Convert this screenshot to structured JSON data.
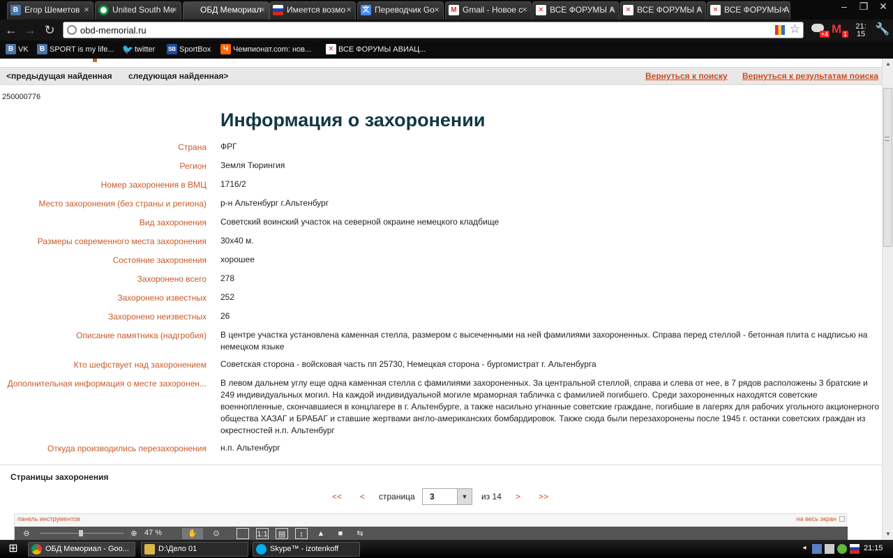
{
  "browser": {
    "tabs": [
      {
        "label": "Егор Шеметов",
        "favicon": "В",
        "favicon_class": "fav-vk",
        "close": "×"
      },
      {
        "label": "United South Me",
        "favicon": "",
        "favicon_class": "fav-ring",
        "close": "×"
      },
      {
        "label": "ОБД Мемориал",
        "favicon": "",
        "favicon_class": "fav-memorial",
        "close": "×"
      },
      {
        "label": "Имеется возмо",
        "favicon": "",
        "favicon_class": "fav-flag",
        "close": "×"
      },
      {
        "label": "Переводчик Go",
        "favicon": "文",
        "favicon_class": "fav-tr",
        "close": "×"
      },
      {
        "label": "Gmail - Новое с",
        "favicon": "M",
        "favicon_class": "fav-gmail",
        "close": "×"
      },
      {
        "label": "ВСЕ ФОРУМЫ А",
        "favicon": "✕",
        "favicon_class": "fav-forum",
        "close": "×"
      },
      {
        "label": "ВСЕ ФОРУМЫ А",
        "favicon": "✕",
        "favicon_class": "fav-forum",
        "close": "×"
      },
      {
        "label": "ВСЕ ФОРУМЫ А",
        "favicon": "✕",
        "favicon_class": "fav-forum",
        "close": "×"
      }
    ],
    "active_tab_index": 2,
    "window_controls": {
      "minimize": "–",
      "restore": "❐",
      "close": "✕"
    },
    "nav": {
      "back": "←",
      "forward": "→",
      "reload": "↻"
    },
    "url": "obd-memorial.ru",
    "star": "☆",
    "extensions": {
      "weather_badge": "+4",
      "gmail_letter": "M",
      "gmail_badge": "1",
      "clock_h": "21:",
      "clock_m": "15",
      "wrench": "🔧"
    },
    "bookmarks": [
      {
        "label": "VK",
        "icon": "В",
        "icon_class": "bi-vk"
      },
      {
        "label": "SPORT is my life...",
        "icon": "В",
        "icon_class": "bi-vk"
      },
      {
        "label": "twitter",
        "icon": "🐦",
        "icon_class": "bi-tw"
      },
      {
        "label": "SportBox",
        "icon": "SB",
        "icon_class": "bi-sb"
      },
      {
        "label": "Чемпионат.com: нов...",
        "icon": "Ч",
        "icon_class": "bi-ch"
      },
      {
        "label": "ВСЕ ФОРУМЫ АВИАЦ...",
        "icon": "✕",
        "icon_class": "bi-forum"
      }
    ]
  },
  "page": {
    "nav": {
      "prev": "<предыдущая найденная",
      "next": "следующая найденная>",
      "back_to_search": "Вернуться к поиску",
      "back_to_results": "Вернуться к результатам поиска"
    },
    "record_id": "250000776",
    "title": "Информация о захоронении",
    "fields": [
      {
        "label": "Страна",
        "value": "ФРГ"
      },
      {
        "label": "Регион",
        "value": "Земля Тюрингия"
      },
      {
        "label": "Номер захоронения в ВМЦ",
        "value": "1716/2"
      },
      {
        "label": "Место захоронения (без страны и региона)",
        "value": "р-н Альтенбург г.Альтенбург"
      },
      {
        "label": "Вид захоронения",
        "value": "Советский воинский участок на северной окраине немецкого кладбище"
      },
      {
        "label": "Размеры современного места захоронения",
        "value": "30х40 м."
      },
      {
        "label": "Состояние захоронения",
        "value": "хорошее"
      },
      {
        "label": "Захоронено всего",
        "value": "278"
      },
      {
        "label": "Захоронено известных",
        "value": "252"
      },
      {
        "label": "Захоронено неизвестных",
        "value": "26"
      },
      {
        "label": "Описание памятника (надгробия)",
        "value": "В центре участка установлена каменная стелла, размером  с высеченными на ней фамилиями захороненных. Справа перед стеллой - бетонная плита с надписью на немецком языке"
      },
      {
        "label": "Кто шефствует над захоронением",
        "value": "Советская сторона - войсковая часть пп 25730, Немецкая сторона - бургомистрат г. Альтенбурга"
      },
      {
        "label": "Дополнительная информация о месте захоронен...",
        "value": "В левом дальнем углу еще одна каменная стелла с фамилиями захороненных. За центральной стеллой, справа и слева от нее, в 7 рядов расположены 3 братские и 249 индивидуальных могил. На каждой индивидуальной могиле мраморная табличка с фамилией погибшего. Среди захороненных находятся советские военнопленные, скончавшиеся в концлагере в г. Альтенбурге, а также насильно угнанные советские граждане, погибшие в лагерях для рабочих угольного акционерного общества ХАЗАГ и БРАБАГ и ставшие жертвами англо-американских бомбардировок. Также сюда были перезахоронены после 1945 г. останки советских граждан из окрестностей н.п. Альтенбург"
      },
      {
        "label": "Откуда производились перезахоронения",
        "value": "н.п. Альтенбург"
      }
    ],
    "pages_section_title": "Страницы захоронения",
    "pager": {
      "first": "<<",
      "prev": "<",
      "label": "страница",
      "current": "3",
      "of_text": "из 14",
      "next": ">",
      "last": ">>",
      "dropdown_arrow": "▼"
    },
    "viewer": {
      "title": "панель инструментов",
      "fullscreen": "на весь экран",
      "zoom_out": "⊖",
      "zoom_in": "⊕",
      "zoom_percent": "47 %",
      "zoom_level": 0.47,
      "tools": [
        "✋",
        "⊙",
        "",
        "1:1",
        "▤",
        "↕",
        "▲",
        "■",
        "⇆"
      ]
    },
    "scrollbar": {
      "up": "▲",
      "down": "▼"
    }
  },
  "taskbar": {
    "start": "⊞",
    "tasks": [
      {
        "label": "ОБД Мемориал - Goo...",
        "icon_class": "ti-chrome"
      },
      {
        "label": "D:\\Дело 01",
        "icon_class": "ti-folder"
      },
      {
        "label": "Skype™ - izotenkoff",
        "icon_class": "ti-skype"
      }
    ],
    "clock": "21:15"
  },
  "colors": {
    "accent": "#d04a1a",
    "label": "#c95a28",
    "title": "#123744"
  }
}
